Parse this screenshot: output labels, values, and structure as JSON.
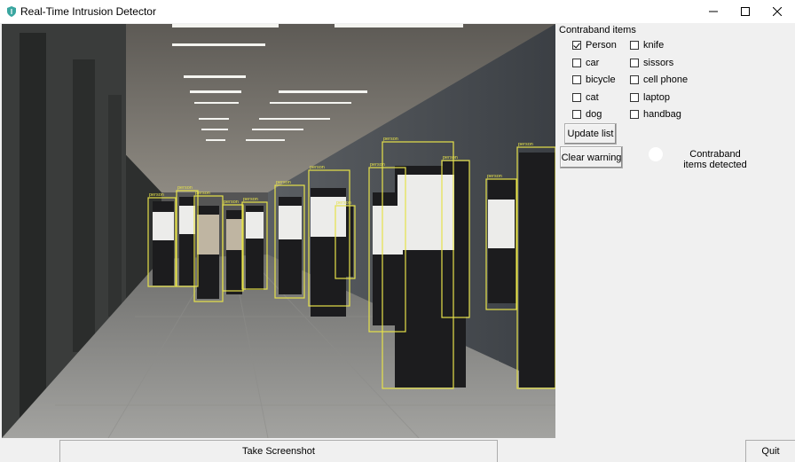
{
  "window": {
    "title": "Real-Time Intrusion Detector",
    "app_icon": "shield-icon",
    "controls": [
      "minimize-icon",
      "maximize-icon",
      "close-icon"
    ]
  },
  "video": {
    "detection_label": "person",
    "box_color": "#e6e24a"
  },
  "panel": {
    "title": "Contraband items",
    "items": [
      {
        "label": "Person",
        "checked": true
      },
      {
        "label": "knife",
        "checked": false
      },
      {
        "label": "car",
        "checked": false
      },
      {
        "label": "sissors",
        "checked": false
      },
      {
        "label": "bicycle",
        "checked": false
      },
      {
        "label": "cell phone",
        "checked": false
      },
      {
        "label": "cat",
        "checked": false
      },
      {
        "label": "laptop",
        "checked": false
      },
      {
        "label": "dog",
        "checked": false
      },
      {
        "label": "handbag",
        "checked": false
      }
    ],
    "update_button": "Update list",
    "clear_button": "Clear warning",
    "status_line1": "Contraband",
    "status_line2": "items detected",
    "indicator_color": "#ffffff"
  },
  "footer": {
    "screenshot_button": "Take Screenshot",
    "quit_button": "Quit"
  }
}
